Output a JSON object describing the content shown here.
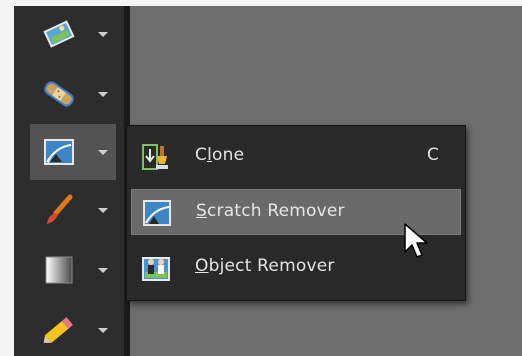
{
  "toolbar": {
    "tools": [
      {
        "icon": "image-adjust-icon",
        "selected": false
      },
      {
        "icon": "bandage-icon",
        "selected": false
      },
      {
        "icon": "scratch-remover-icon",
        "selected": true
      },
      {
        "icon": "paintbrush-icon",
        "selected": false
      },
      {
        "icon": "gradient-icon",
        "selected": false
      },
      {
        "icon": "pencil-eraser-icon",
        "selected": false
      }
    ]
  },
  "flyout_menu": {
    "items": [
      {
        "label_pre": "C",
        "label_mn": "l",
        "label_post": "one",
        "shortcut": "C",
        "icon": "clone-stamp-icon",
        "highlighted": false
      },
      {
        "label_pre": "",
        "label_mn": "S",
        "label_post": "cratch Remover",
        "shortcut": "",
        "icon": "scratch-remover-icon",
        "highlighted": true
      },
      {
        "label_pre": "",
        "label_mn": "O",
        "label_post": "bject Remover",
        "shortcut": "",
        "icon": "object-remover-icon",
        "highlighted": false
      }
    ]
  },
  "colors": {
    "canvas": "#6e6e6e",
    "toolbar": "#2d2d2d",
    "menu": "#2a2a2a",
    "highlight": "#6a6a6a"
  }
}
